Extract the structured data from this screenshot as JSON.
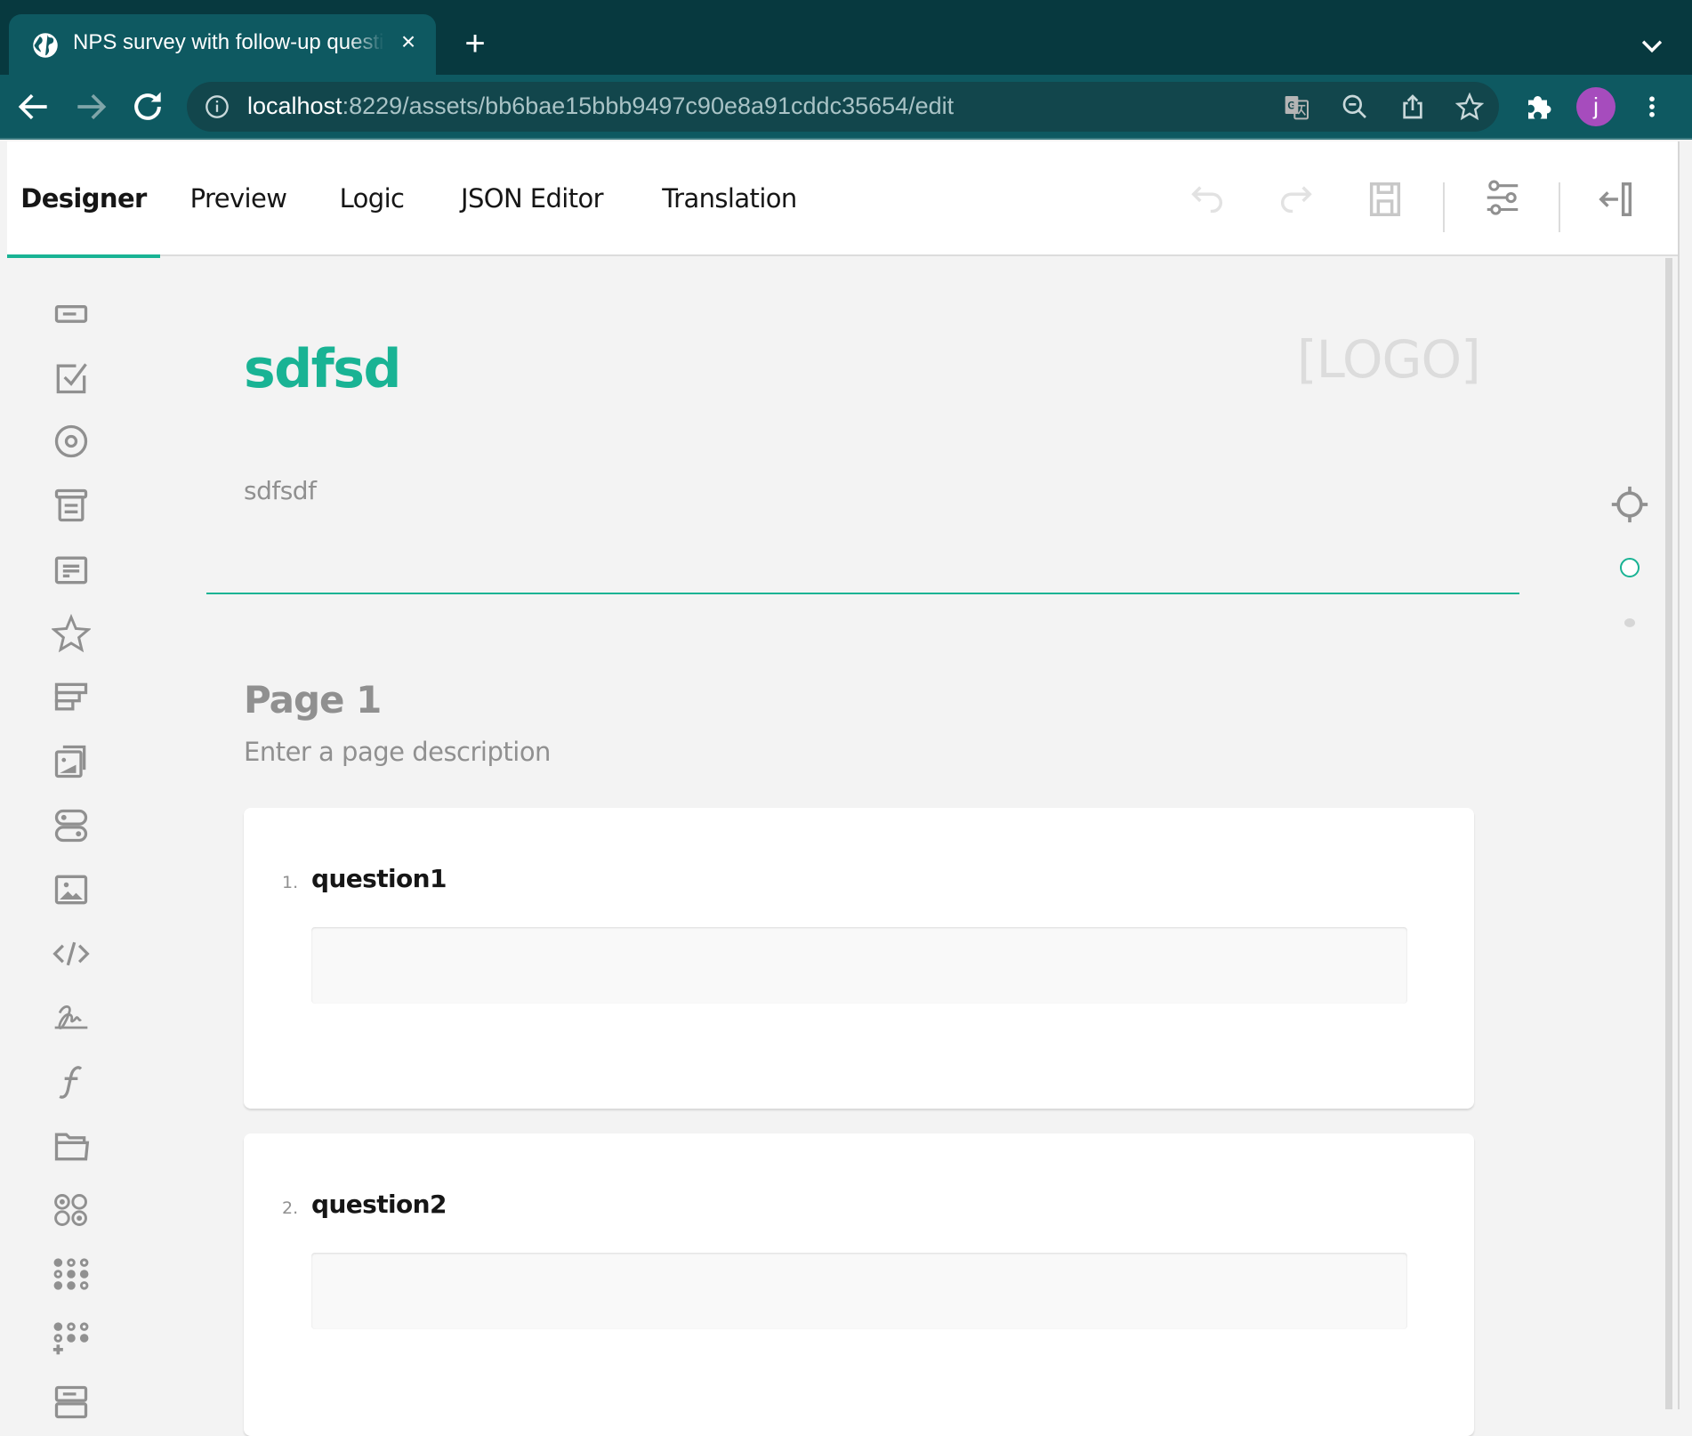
{
  "browser": {
    "tab_title": "NPS survey with follow-up questions",
    "new_tab_label": "+",
    "close_tab_label": "×",
    "url_host": "localhost",
    "url_rest": ":8229/assets/bb6bae15bbb9497c90e8a91cddc35654/edit",
    "profile_initial": "j"
  },
  "toolbar": {
    "tabs": [
      {
        "label": "Designer",
        "active": true
      },
      {
        "label": "Preview",
        "active": false
      },
      {
        "label": "Logic",
        "active": false
      },
      {
        "label": "JSON Editor",
        "active": false
      },
      {
        "label": "Translation",
        "active": false
      }
    ],
    "actions": [
      "undo-icon",
      "redo-icon",
      "save-icon",
      "settings-sliders-icon",
      "collapse-panel-icon"
    ]
  },
  "toolbox": {
    "items": [
      "single-line-input-icon",
      "checkbox-icon",
      "radiogroup-icon",
      "dropdown-icon",
      "comment-icon",
      "rating-icon",
      "ranking-icon",
      "image-picker-icon",
      "boolean-icon",
      "image-icon",
      "html-icon",
      "signature-pad-icon",
      "expression-icon",
      "file-upload-icon",
      "matrix-single-icon",
      "matrix-multi-icon",
      "matrix-dynamic-icon",
      "multiple-text-icon"
    ]
  },
  "survey": {
    "title": "sdfsd",
    "description": "sdfsdf",
    "logo_placeholder": "[LOGO]",
    "page": {
      "title": "Page 1",
      "description_placeholder": "Enter a page description",
      "questions": [
        {
          "number": "1.",
          "title": "question1",
          "value": ""
        },
        {
          "number": "2.",
          "title": "question2",
          "value": ""
        }
      ]
    }
  },
  "colors": {
    "accent": "#19b394",
    "chrome_dark": "#07393f",
    "chrome_tab": "#0e5961",
    "avatar": "#a64cbd"
  }
}
